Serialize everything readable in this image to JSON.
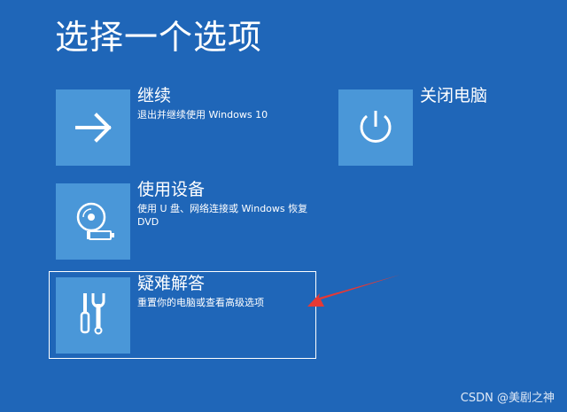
{
  "page": {
    "title": "选择一个选项"
  },
  "options": {
    "continue": {
      "title": "继续",
      "description": "退出并继续使用 Windows 10",
      "icon": "arrow-right-icon"
    },
    "use_device": {
      "title": "使用设备",
      "description": "使用 U 盘、网络连接或 Windows 恢复 DVD",
      "icon": "disc-usb-icon"
    },
    "troubleshoot": {
      "title": "疑难解答",
      "description": "重置你的电脑或查看高级选项",
      "icon": "tools-icon"
    },
    "power_off": {
      "title": "关闭电脑",
      "icon": "power-icon"
    }
  },
  "annotation": {
    "arrow_color": "#e53935"
  },
  "watermark": {
    "text": "CSDN @美剧之神"
  },
  "colors": {
    "background": "#1f66b8",
    "tile": "#4a97d8",
    "text": "#ffffff"
  }
}
